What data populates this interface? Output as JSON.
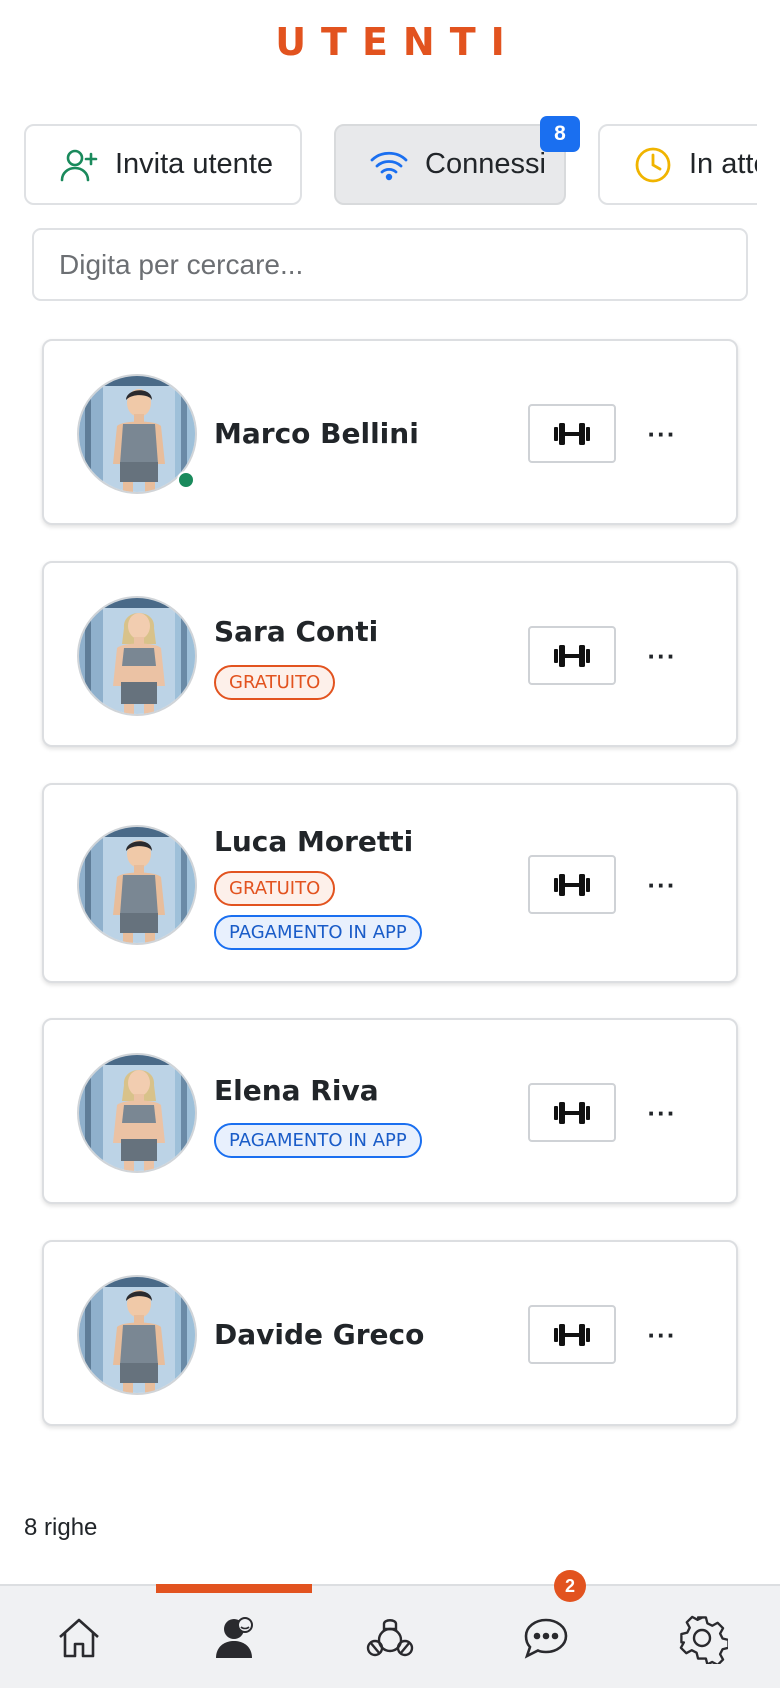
{
  "header": {
    "title": "UTENTI"
  },
  "tabs": [
    {
      "label": "Invita utente",
      "icon": "add-user-icon",
      "active": false
    },
    {
      "label": "Connessi",
      "icon": "wifi-icon",
      "active": true,
      "badge": "8"
    },
    {
      "label": "In atte",
      "icon": "clock-icon",
      "active": false
    }
  ],
  "search": {
    "placeholder": "Digita per cercare...",
    "value": ""
  },
  "users": [
    {
      "name": "Marco Bellini",
      "avatar": "male-athlete",
      "online": true,
      "tags": []
    },
    {
      "name": "Sara Conti",
      "avatar": "female-athlete",
      "online": false,
      "tags": [
        "GRATUITO"
      ]
    },
    {
      "name": "Luca Moretti",
      "avatar": "male-athlete",
      "online": false,
      "tags": [
        "GRATUITO",
        "PAGAMENTO IN APP"
      ]
    },
    {
      "name": "Elena Riva",
      "avatar": "female-athlete",
      "online": false,
      "tags": [
        "PAGAMENTO IN APP"
      ]
    },
    {
      "name": "Davide Greco",
      "avatar": "male-athlete",
      "online": false,
      "tags": []
    }
  ],
  "actions": {
    "workout_icon": "dumbbell-icon",
    "more_label": "···"
  },
  "footer": {
    "row_count": "8 righe"
  },
  "bottom_nav": {
    "items": [
      "home-icon",
      "users-icon",
      "workout-icon",
      "chat-icon",
      "settings-icon"
    ],
    "active": "users-icon",
    "chat_badge": "2"
  },
  "colors": {
    "accent": "#e2531f",
    "primary": "#1a6ff0",
    "online": "#1a8a5c"
  }
}
